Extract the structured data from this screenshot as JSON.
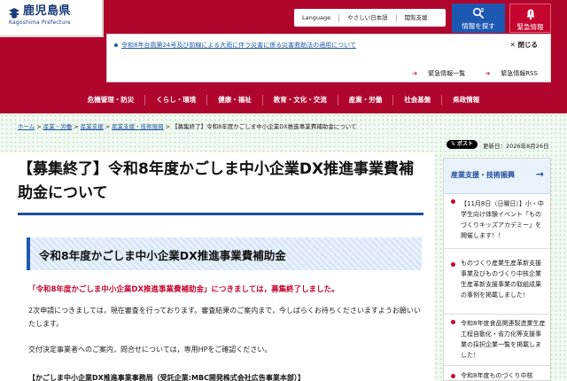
{
  "header": {
    "logo_name": "鹿児島県",
    "logo_english": "Kagoshima Prefecture",
    "utility_links": [
      "Language",
      "やさしい日本語",
      "閲覧支援"
    ],
    "search_label": "情報を探す",
    "emergency_label": "緊急情報"
  },
  "notice": {
    "link_text": "令和8年台風第24号及び前線による大雨に伴う災害に係る災害救助法の適用について",
    "close_label": "閉じる",
    "list_link": "緊急情報一覧",
    "rss_link": "緊急情報RSS"
  },
  "nav": {
    "items": [
      "危機管理・防災",
      "くらし・環境",
      "健康・福祉",
      "教育・文化・交流",
      "産業・労働",
      "社会基盤",
      "県政情報"
    ]
  },
  "breadcrumb": {
    "items": [
      "ホーム",
      "産業・労働",
      "産業支援",
      "産業支援・技術振興"
    ],
    "current": "【募集終了】令和8年度かごしま中小企業DX推進事業費補助金について"
  },
  "share": {
    "post_label": "ポスト"
  },
  "updated": "更新日：2026年8月26日",
  "article": {
    "title": "【募集終了】令和8年度かごしま中小企業DX推進事業費補助金について",
    "section_heading": "令和8年度かごしま中小企業DX推進事業費補助金",
    "closed_message": "「令和8年度かごしま中小企業DX推進事業費補助金」につきましては，募集終了しました。",
    "paragraph1": "2次申請につきましては，現在審査を行っております。審査結果のご案内まで，今しばらくお待ちくださいますようお願いいたします。",
    "paragraph2": "交付決定事業者へのご案内，問合せについては，専用HPをご確認ください。",
    "office": "【かごしま中小企業DX推進事業事務局（受託企業:MBC開発株式会社広告事業本部）】"
  },
  "sidebar": {
    "heading": "産業支援・技術振興",
    "items": [
      "【11月8日（日曜日）】小・中学生向け体験イベント「ものづくりキッズアカデミー」を開催します！！",
      "ものづくり産業生産革新支援事業及びものづくり中核企業生産革新支援事業の取組成果の事例を掲載しました！",
      "令和8年度食品関連製造業生産工程自動化・省力化等支援事業の採択企業一覧を掲載しました！",
      "令和8年度ものづくり中核"
    ]
  },
  "colors": {
    "brand_red": "#b0062e",
    "brand_blue": "#1d58b3",
    "alert_red": "#c4062f",
    "link_blue": "#1f5aa6"
  }
}
